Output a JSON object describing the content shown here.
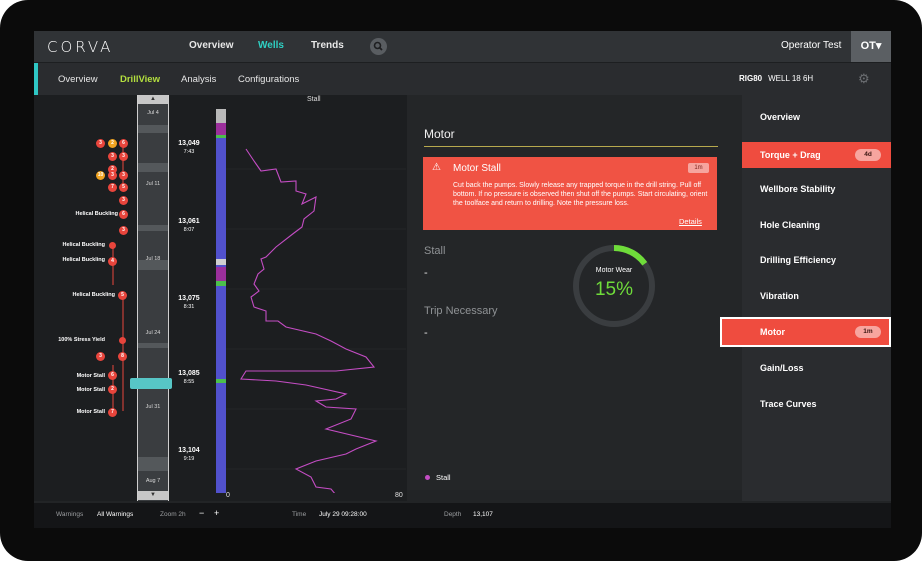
{
  "top_nav": {
    "logo": "CORVA",
    "items": [
      "Overview",
      "Wells",
      "Trends"
    ],
    "active": "Wells",
    "user": "Operator Test",
    "avatar": "OT▾",
    "search_icon": "search-icon"
  },
  "sub_nav": {
    "items": [
      "Overview",
      "DrillView",
      "Analysis",
      "Configurations"
    ],
    "active": "DrillView",
    "rig": "RIG80",
    "well": "WELL 18 6H",
    "settings_icon": "gear-icon"
  },
  "events": [
    {
      "label": "Helical Buckling"
    },
    {
      "label": "Helical Buckling"
    },
    {
      "label": "Helical Buckling"
    },
    {
      "label": "Helical Buckling"
    },
    {
      "label": "100% Stress Yield"
    },
    {
      "label": "Motor Stall"
    },
    {
      "label": "Motor Stall"
    },
    {
      "label": "Motor Stall"
    }
  ],
  "event_counts": [
    "3",
    "2",
    "6",
    "3",
    "3",
    "2",
    "10",
    "3",
    "3",
    "7",
    "5",
    "3",
    "6",
    "3",
    "4",
    "5",
    "3",
    "8",
    "6",
    "2"
  ],
  "timeline": {
    "dates": [
      "Jul 4",
      "Jul 11",
      "Jul 18",
      "Jul 24",
      "Jul 31",
      "Aug 7"
    ],
    "up_arrow": "▲",
    "down_arrow": "▼"
  },
  "depths": [
    {
      "depth": "13,049",
      "time": "7:43"
    },
    {
      "depth": "13,061",
      "time": "8:07"
    },
    {
      "depth": "13,075",
      "time": "8:31"
    },
    {
      "depth": "13,085",
      "time": "8:55"
    },
    {
      "depth": "13,104",
      "time": "9:19"
    }
  ],
  "chart_data": {
    "type": "line",
    "title": "Stall",
    "xlim": [
      0,
      80
    ],
    "x_ticks": [
      "0",
      "80"
    ],
    "series": [
      {
        "name": "Stall",
        "color": "#c44dc4"
      }
    ]
  },
  "panel": {
    "title": "Motor",
    "alert": {
      "title": "Motor Stall",
      "time": "1m",
      "message": "Cut back the pumps. Slowly release any trapped torque in the drill string. Pull off bottom. If no pressure is observed then shut off the pumps. Start circulating, orient the toolface and return to drilling. Note the pressure loss.",
      "details": "Details",
      "icon": "warning-icon"
    },
    "stall_label": "Stall",
    "stall_value": "-",
    "trip_label": "Trip Necessary",
    "trip_value": "-",
    "gauge_label": "Motor Wear",
    "gauge_value": "15%",
    "gauge_fraction": 0.15,
    "legend": "Stall"
  },
  "sidebar": [
    {
      "label": "Overview"
    },
    {
      "label": "Torque + Drag",
      "badge": "4d",
      "state": "alert"
    },
    {
      "label": "Wellbore Stability"
    },
    {
      "label": "Hole Cleaning"
    },
    {
      "label": "Drilling Efficiency"
    },
    {
      "label": "Vibration"
    },
    {
      "label": "Motor",
      "badge": "1m",
      "state": "selected"
    },
    {
      "label": "Gain/Loss"
    },
    {
      "label": "Trace Curves"
    }
  ],
  "footer": {
    "warnings_label": "Warnings",
    "warnings_value": "All Warnings",
    "zoom_label": "Zoom 2h",
    "zoom_out": "−",
    "zoom_in": "+",
    "time_label": "Time",
    "time_value": "July 29 09:28:00",
    "depth_label": "Depth",
    "depth_value": "13,107"
  }
}
